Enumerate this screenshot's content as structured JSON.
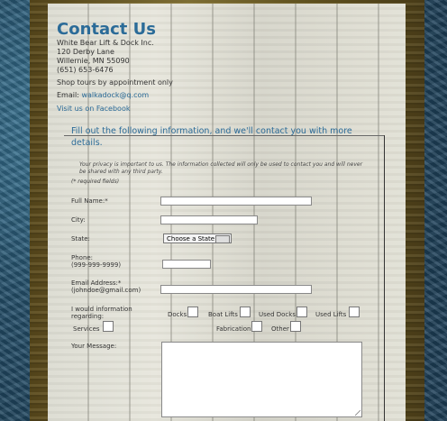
{
  "contact": {
    "title": "Contact Us",
    "company": "White Bear Lift & Dock Inc.",
    "street": "120 Derby Lane",
    "city_state_zip": "Willernie, MN 55090",
    "phone": "(651) 653-6476",
    "tours": "Shop tours by appointment only",
    "email_label": "Email:",
    "email": "walkadock@q.com",
    "facebook": "Visit us on Facebook"
  },
  "form": {
    "intro": "Fill out the following information, and we'll contact you with more details.",
    "privacy": "Your privacy is important to us. The information collected will only be used to contact you and will never be shared with any third party.",
    "required_note": "(* required fields)",
    "full_name_label": "Full Name:*",
    "city_label": "City:",
    "state_label": "State:",
    "state_selected": "Choose a State",
    "phone_label": "Phone:",
    "phone_hint": "(999-999-9999)",
    "email_label": "Email Address:*",
    "email_hint": "(johndoe@gmail.com)",
    "interest_label": "I would information regarding:",
    "options": {
      "docks": "Docks",
      "boat_lifts": "Boat Lifts",
      "used_docks": "Used Docks",
      "used_lifts": "Used Lifts",
      "services": "Services",
      "fabrication": "Fabrication",
      "other": "Other"
    },
    "message_label": "Your Message:"
  }
}
